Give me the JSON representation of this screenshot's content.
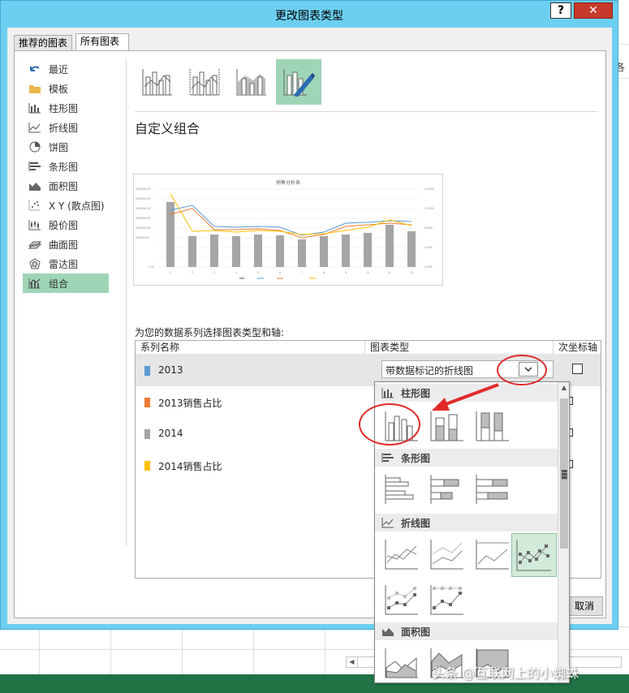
{
  "background": {
    "partial_cell_text": "各"
  },
  "dialog": {
    "title": "更改图表类型",
    "help_label": "?",
    "close_label": "✕",
    "tabs": [
      {
        "label": "推荐的图表"
      },
      {
        "label": "所有图表"
      }
    ],
    "sidebar": [
      {
        "label": "最近",
        "icon": "recent-icon"
      },
      {
        "label": "模板",
        "icon": "folder-icon"
      },
      {
        "label": "柱形图",
        "icon": "column-chart-icon"
      },
      {
        "label": "折线图",
        "icon": "line-chart-icon"
      },
      {
        "label": "饼图",
        "icon": "pie-chart-icon"
      },
      {
        "label": "条形图",
        "icon": "bar-chart-icon"
      },
      {
        "label": "面积图",
        "icon": "area-chart-icon"
      },
      {
        "label": "X Y (散点图)",
        "icon": "scatter-chart-icon"
      },
      {
        "label": "股价图",
        "icon": "stock-chart-icon"
      },
      {
        "label": "曲面图",
        "icon": "surface-chart-icon"
      },
      {
        "label": "雷达图",
        "icon": "radar-chart-icon"
      },
      {
        "label": "组合",
        "icon": "combo-chart-icon"
      }
    ],
    "selected_sidebar": "组合",
    "heading": "自定义组合",
    "preview": {
      "title": "销售分析表"
    },
    "select_prompt": "为您的数据系列选择图表类型和轴:",
    "table": {
      "headers": [
        "系列名称",
        "图表类型",
        "次坐标轴"
      ],
      "rows": [
        {
          "name": "2013",
          "color": "#5b9bd5",
          "chart_type": "带数据标记的折线图",
          "secondary_axis": false
        },
        {
          "name": "2013销售占比",
          "color": "#ed7d31",
          "secondary_axis": true
        },
        {
          "name": "2014",
          "color": "#a5a5a5",
          "secondary_axis": false
        },
        {
          "name": "2014销售占比",
          "color": "#ffc000",
          "secondary_axis": true
        }
      ]
    },
    "cancel_label": "取消"
  },
  "gallery": {
    "sections": [
      {
        "label": "柱形图",
        "icon": "column-chart-icon"
      },
      {
        "label": "条形图",
        "icon": "bar-chart-icon"
      },
      {
        "label": "折线图",
        "icon": "line-chart-icon"
      },
      {
        "label": "面积图",
        "icon": "area-chart-icon"
      }
    ]
  },
  "watermark": "头条 @互联网上的小蜘蛛",
  "colors": {
    "title_bar": "#6dcff0",
    "close_button": "#c7392a",
    "selection_green": "#9fd5b7",
    "annotation_red": "#e02a2a",
    "status_bar": "#217346"
  }
}
